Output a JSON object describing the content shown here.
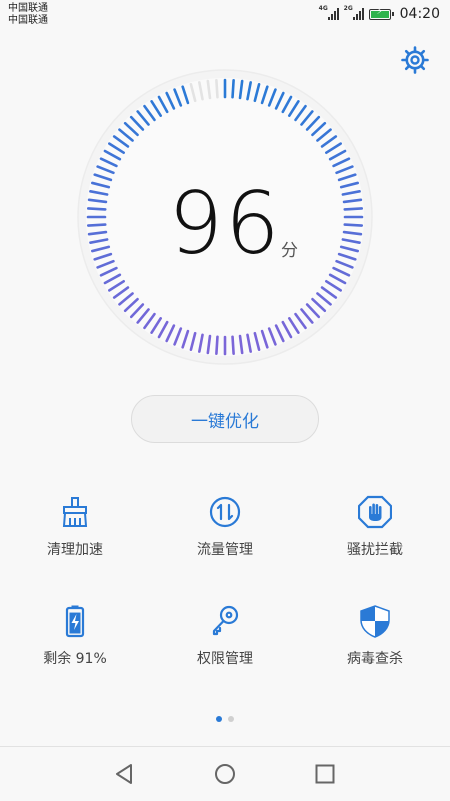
{
  "status_bar": {
    "carrier_1": "中国联通",
    "carrier_2": "中国联通",
    "signal_1_tag": "4G",
    "signal_2_tag": "2G",
    "battery_color": "#2fb24c",
    "time": "04:20"
  },
  "header": {
    "settings_icon": "gear-icon"
  },
  "gauge": {
    "score": "96",
    "unit": "分",
    "score_value": 96,
    "max_value": 100,
    "active_colors": [
      "#2a7ad6",
      "#7b66d8"
    ],
    "inactive_color": "#e3e3e3"
  },
  "optimize_button": {
    "label": "一键优化"
  },
  "tools": [
    {
      "label": "清理加速",
      "icon": "broom-icon"
    },
    {
      "label": "流量管理",
      "icon": "data-traffic-icon"
    },
    {
      "label": "骚扰拦截",
      "icon": "hand-block-icon"
    },
    {
      "label": "剩余 91%",
      "icon": "battery-icon",
      "battery_level_percent": 91
    },
    {
      "label": "权限管理",
      "icon": "key-icon"
    },
    {
      "label": "病毒查杀",
      "icon": "shield-icon"
    }
  ],
  "pager": {
    "page_count": 2,
    "active_index": 0
  },
  "navigation": {
    "back_icon": "back-triangle-icon",
    "home_icon": "home-circle-icon",
    "recent_icon": "recent-square-icon"
  },
  "theme": {
    "accent": "#2a7ad6",
    "background": "#f8f8f8"
  }
}
